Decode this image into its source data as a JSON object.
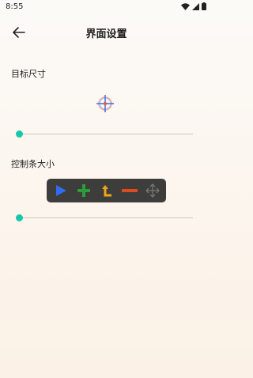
{
  "status": {
    "time": "8:55"
  },
  "header": {
    "title": "界面设置"
  },
  "target_size": {
    "label": "目标尺寸",
    "slider_value": 0
  },
  "control_bar_size": {
    "label": "控制条大小",
    "slider_value": 0
  },
  "control_bar": {
    "buttons": [
      "play-icon",
      "plus-icon",
      "return-arrow-icon",
      "minus-icon",
      "move-icon"
    ]
  },
  "colors": {
    "accent": "#18c7a8",
    "play": "#2f6cf0",
    "plus": "#2e9b3a",
    "return": "#f0a51c",
    "minus": "#e0481d",
    "move": "#777777"
  }
}
